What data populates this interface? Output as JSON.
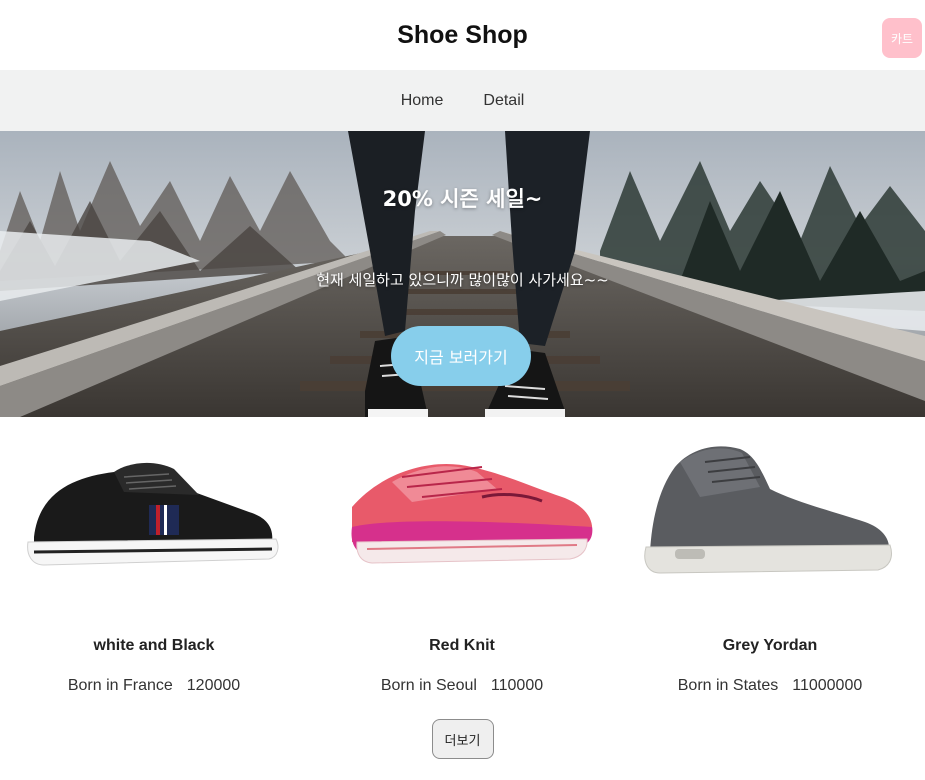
{
  "header": {
    "brand": "Shoe Shop",
    "cart_label": "카트"
  },
  "nav": {
    "items": [
      {
        "label": "Home"
      },
      {
        "label": "Detail"
      }
    ]
  },
  "hero": {
    "title": "20% 시즌 세일~",
    "subtitle": "현재 세일하고 있으니까 많이많이 사가세요~~",
    "button_label": "지금 보러가기"
  },
  "products": [
    {
      "name": "white and Black",
      "origin": "Born in France",
      "price": "120000",
      "icon": "black-sneaker-image"
    },
    {
      "name": "Red Knit",
      "origin": "Born in Seoul",
      "price": "110000",
      "icon": "red-running-shoe-image"
    },
    {
      "name": "Grey Yordan",
      "origin": "Born in States",
      "price": "11000000",
      "icon": "grey-high-top-image"
    }
  ],
  "more_button_label": "더보기",
  "colors": {
    "cart": "#ffc0cb",
    "nav_bg": "#f1f2f2",
    "hero_button": "#87ceeb"
  }
}
